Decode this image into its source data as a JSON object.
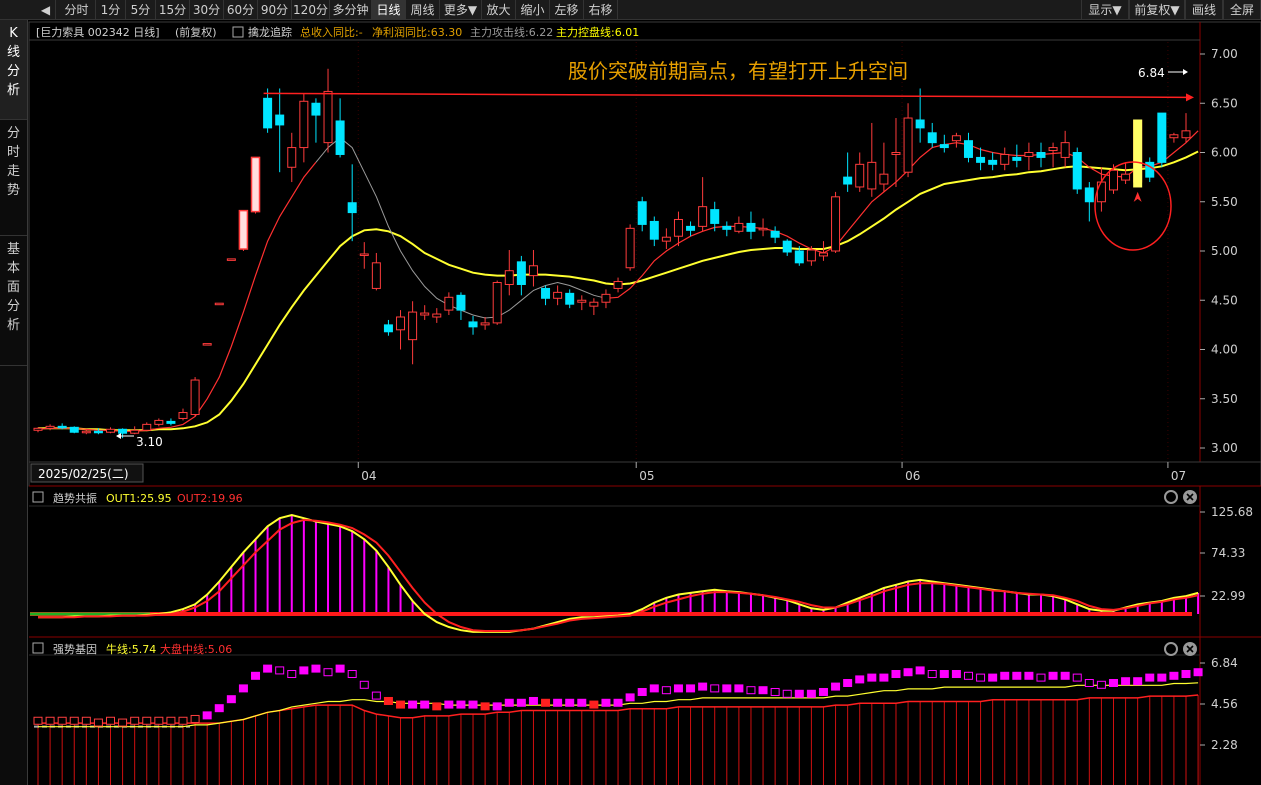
{
  "toolbar": {
    "items": [
      "分时",
      "1分",
      "5分",
      "15分",
      "30分",
      "60分",
      "90分",
      "120分",
      "多分钟",
      "日线",
      "周线",
      "更多▼",
      "放大",
      "缩小",
      "左移",
      "右移"
    ],
    "active": "日线",
    "right_items": [
      "显示▼",
      "前复权▼",
      "画线",
      "全屏"
    ]
  },
  "sidebar": {
    "tabs": [
      "K线分析",
      "分时走势",
      "基本面分析"
    ],
    "active": "K线分析"
  },
  "main_header": {
    "stock": "[巨力索具 002342 日线]",
    "adjust": "(前复权)",
    "indicator_name": "擒龙追踪",
    "items": [
      {
        "text": "总收入同比:-",
        "color": "#e0a000"
      },
      {
        "text": "净利润同比:63.30",
        "color": "#e0a000"
      },
      {
        "text": "主力攻击线:6.22",
        "color": "#9a9a9a"
      },
      {
        "text": "主力控盘线:6.01",
        "color": "#ffff00"
      }
    ]
  },
  "annotation": {
    "text": "股价突破前期高点，有望打开上升空间",
    "color": "#e8a000",
    "high_label": "6.84",
    "low_label": "3.10"
  },
  "date_axis": {
    "cursor_date": "2025/02/25(二)",
    "months": [
      "04",
      "05",
      "06",
      "07"
    ]
  },
  "price_axis": [
    "7.00",
    "6.50",
    "6.00",
    "5.50",
    "5.00",
    "4.50",
    "4.00",
    "3.50",
    "3.00"
  ],
  "panel2": {
    "name": "趋势共振",
    "out1": "OUT1:25.95",
    "out2": "OUT2:19.96",
    "axis": [
      "125.68",
      "74.33",
      "22.99"
    ]
  },
  "panel3": {
    "name": "强势基因",
    "bull": "牛线:5.74",
    "mid": "大盘中线:5.06",
    "axis": [
      "6.84",
      "4.56",
      "2.28"
    ]
  },
  "colors": {
    "up": "#ff3c3c",
    "down": "#00e5ff",
    "ma_yellow": "#ffff30",
    "ma_red": "#ff3030",
    "magenta": "#ff00ff"
  },
  "chart_data": {
    "type": "candlestick",
    "ylim": [
      3.0,
      7.0
    ],
    "candles": [
      [
        3.18,
        3.2,
        3.16,
        3.21
      ],
      [
        3.2,
        3.22,
        3.18,
        3.24
      ],
      [
        3.22,
        3.21,
        3.19,
        3.25
      ],
      [
        3.21,
        3.16,
        3.15,
        3.22
      ],
      [
        3.16,
        3.17,
        3.14,
        3.19
      ],
      [
        3.17,
        3.16,
        3.14,
        3.2
      ],
      [
        3.16,
        3.19,
        3.15,
        3.21
      ],
      [
        3.19,
        3.15,
        3.1,
        3.2
      ],
      [
        3.15,
        3.18,
        3.14,
        3.22
      ],
      [
        3.18,
        3.24,
        3.17,
        3.26
      ],
      [
        3.24,
        3.28,
        3.22,
        3.3
      ],
      [
        3.27,
        3.25,
        3.23,
        3.3
      ],
      [
        3.3,
        3.36,
        3.28,
        3.4
      ],
      [
        3.34,
        3.69,
        3.32,
        3.72
      ],
      [
        4.06,
        4.06,
        4.06,
        4.06
      ],
      [
        4.47,
        4.47,
        4.47,
        4.47
      ],
      [
        4.92,
        4.92,
        4.92,
        4.92
      ],
      [
        5.02,
        5.41,
        5.0,
        5.41
      ],
      [
        5.4,
        5.95,
        5.38,
        5.95
      ],
      [
        6.55,
        6.25,
        6.2,
        6.65
      ],
      [
        6.38,
        6.28,
        5.8,
        6.65
      ],
      [
        5.85,
        6.05,
        5.7,
        6.2
      ],
      [
        6.05,
        6.52,
        5.9,
        6.6
      ],
      [
        6.5,
        6.38,
        6.1,
        6.55
      ],
      [
        6.1,
        6.62,
        6.0,
        6.85
      ],
      [
        6.32,
        5.98,
        5.95,
        6.55
      ],
      [
        5.49,
        5.39,
        5.1,
        5.88
      ],
      [
        4.96,
        4.97,
        4.82,
        5.09
      ],
      [
        4.62,
        4.88,
        4.6,
        4.98
      ],
      [
        4.25,
        4.18,
        4.14,
        4.3
      ],
      [
        4.2,
        4.33,
        4.0,
        4.4
      ],
      [
        4.1,
        4.38,
        3.85,
        4.49
      ],
      [
        4.35,
        4.37,
        4.3,
        4.45
      ],
      [
        4.33,
        4.36,
        4.27,
        4.42
      ],
      [
        4.4,
        4.53,
        4.35,
        4.58
      ],
      [
        4.55,
        4.4,
        4.3,
        4.58
      ],
      [
        4.28,
        4.23,
        4.15,
        4.34
      ],
      [
        4.25,
        4.27,
        4.2,
        4.33
      ],
      [
        4.27,
        4.68,
        4.25,
        4.7
      ],
      [
        4.66,
        4.8,
        4.55,
        5.01
      ],
      [
        4.89,
        4.66,
        4.55,
        4.95
      ],
      [
        4.75,
        4.85,
        4.64,
        5.01
      ],
      [
        4.62,
        4.52,
        4.45,
        4.65
      ],
      [
        4.52,
        4.58,
        4.45,
        4.65
      ],
      [
        4.57,
        4.46,
        4.42,
        4.61
      ],
      [
        4.48,
        4.5,
        4.4,
        4.55
      ],
      [
        4.44,
        4.48,
        4.35,
        4.52
      ],
      [
        4.48,
        4.56,
        4.42,
        4.61
      ],
      [
        4.62,
        4.69,
        4.58,
        4.73
      ],
      [
        4.83,
        5.23,
        4.8,
        5.27
      ],
      [
        5.5,
        5.27,
        5.2,
        5.55
      ],
      [
        5.3,
        5.12,
        5.05,
        5.35
      ],
      [
        5.1,
        5.14,
        5.02,
        5.23
      ],
      [
        5.15,
        5.32,
        5.05,
        5.4
      ],
      [
        5.25,
        5.21,
        5.15,
        5.3
      ],
      [
        5.25,
        5.45,
        5.2,
        5.75
      ],
      [
        5.42,
        5.28,
        5.2,
        5.5
      ],
      [
        5.25,
        5.22,
        5.15,
        5.3
      ],
      [
        5.2,
        5.28,
        5.18,
        5.35
      ],
      [
        5.28,
        5.2,
        5.12,
        5.4
      ],
      [
        5.22,
        5.23,
        5.15,
        5.33
      ],
      [
        5.2,
        5.14,
        5.08,
        5.25
      ],
      [
        5.1,
        4.99,
        4.95,
        5.12
      ],
      [
        5.0,
        4.88,
        4.85,
        5.05
      ],
      [
        4.9,
        5.01,
        4.85,
        5.05
      ],
      [
        4.95,
        4.98,
        4.9,
        5.1
      ],
      [
        5.0,
        5.55,
        4.98,
        5.6
      ],
      [
        5.75,
        5.68,
        5.6,
        6.0
      ],
      [
        5.65,
        5.88,
        5.6,
        6.0
      ],
      [
        5.63,
        5.9,
        5.55,
        6.3
      ],
      [
        5.68,
        5.78,
        5.6,
        6.1
      ],
      [
        5.98,
        6.0,
        5.65,
        6.35
      ],
      [
        5.8,
        6.35,
        5.75,
        6.5
      ],
      [
        6.33,
        6.25,
        6.1,
        6.65
      ],
      [
        6.2,
        6.1,
        6.05,
        6.3
      ],
      [
        6.08,
        6.05,
        6.0,
        6.18
      ],
      [
        6.12,
        6.17,
        6.05,
        6.2
      ],
      [
        6.12,
        5.95,
        5.9,
        6.2
      ],
      [
        5.95,
        5.9,
        5.82,
        6.05
      ],
      [
        5.92,
        5.88,
        5.82,
        6.0
      ],
      [
        5.88,
        5.98,
        5.82,
        6.05
      ],
      [
        5.95,
        5.92,
        5.85,
        6.08
      ],
      [
        5.96,
        6.0,
        5.82,
        6.1
      ],
      [
        6.0,
        5.95,
        5.85,
        6.1
      ],
      [
        6.02,
        6.05,
        5.85,
        6.1
      ],
      [
        5.95,
        6.1,
        5.85,
        6.22
      ],
      [
        6.0,
        5.63,
        5.58,
        6.05
      ],
      [
        5.64,
        5.5,
        5.3,
        5.7
      ],
      [
        5.5,
        5.7,
        5.4,
        5.85
      ],
      [
        5.62,
        5.82,
        5.58,
        5.88
      ],
      [
        5.72,
        5.78,
        5.68,
        5.9
      ],
      [
        5.7,
        6.33,
        5.65,
        6.33
      ],
      [
        5.9,
        5.75,
        5.7,
        5.95
      ],
      [
        6.4,
        5.9,
        5.85,
        6.4
      ],
      [
        6.15,
        6.18,
        6.1,
        6.2
      ],
      [
        6.15,
        6.22,
        6.1,
        6.4
      ]
    ],
    "ma_short": [
      3.19,
      3.2,
      3.2,
      3.2,
      3.19,
      3.18,
      3.18,
      3.17,
      3.17,
      3.18,
      3.2,
      3.21,
      3.24,
      3.32,
      3.5,
      3.72,
      4.03,
      4.38,
      4.75,
      5.1,
      5.35,
      5.55,
      5.75,
      5.9,
      6.05,
      6.15,
      6.05,
      5.8,
      5.55,
      5.25,
      5.0,
      4.8,
      4.64,
      4.52,
      4.45,
      4.4,
      4.35,
      4.32,
      4.33,
      4.4,
      4.5,
      4.6,
      4.65,
      4.68,
      4.65,
      4.6,
      4.55,
      4.52,
      4.53,
      4.62,
      4.75,
      4.9,
      5.0,
      5.08,
      5.15,
      5.2,
      5.24,
      5.25,
      5.25,
      5.24,
      5.23,
      5.2,
      5.15,
      5.08,
      5.02,
      4.98,
      5.05,
      5.2,
      5.35,
      5.5,
      5.6,
      5.7,
      5.82,
      5.95,
      6.05,
      6.08,
      6.1,
      6.08,
      6.03,
      6.0,
      5.98,
      5.97,
      5.97,
      5.98,
      5.99,
      6.0,
      5.95,
      5.85,
      5.78,
      5.76,
      5.75,
      5.85,
      5.86,
      5.9,
      6.0,
      6.1,
      6.22
    ],
    "ma_long": [
      3.2,
      3.2,
      3.2,
      3.2,
      3.19,
      3.19,
      3.18,
      3.18,
      3.18,
      3.18,
      3.19,
      3.19,
      3.2,
      3.22,
      3.26,
      3.34,
      3.48,
      3.65,
      3.85,
      4.05,
      4.25,
      4.43,
      4.6,
      4.75,
      4.9,
      5.05,
      5.15,
      5.21,
      5.22,
      5.2,
      5.15,
      5.07,
      4.98,
      4.92,
      4.86,
      4.82,
      4.78,
      4.76,
      4.75,
      4.75,
      4.76,
      4.76,
      4.76,
      4.75,
      4.74,
      4.72,
      4.7,
      4.67,
      4.66,
      4.67,
      4.7,
      4.74,
      4.78,
      4.82,
      4.86,
      4.9,
      4.93,
      4.96,
      4.99,
      5.01,
      5.02,
      5.03,
      5.03,
      5.02,
      5.02,
      5.02,
      5.05,
      5.1,
      5.17,
      5.25,
      5.33,
      5.42,
      5.5,
      5.58,
      5.63,
      5.68,
      5.7,
      5.72,
      5.74,
      5.75,
      5.77,
      5.78,
      5.8,
      5.81,
      5.83,
      5.85,
      5.86,
      5.85,
      5.84,
      5.83,
      5.82,
      5.83,
      5.84,
      5.86,
      5.9,
      5.95,
      6.01
    ],
    "out1": [
      -4,
      -4,
      -4,
      -3,
      -3,
      -3,
      -2,
      -2,
      -2,
      -1,
      0,
      2,
      6,
      12,
      24,
      40,
      58,
      76,
      92,
      108,
      118,
      122,
      118,
      114,
      111,
      108,
      102,
      92,
      78,
      58,
      36,
      16,
      0,
      -10,
      -16,
      -20,
      -22,
      -22,
      -22,
      -22,
      -20,
      -18,
      -14,
      -10,
      -6,
      -4,
      -4,
      -3,
      -2,
      0,
      6,
      14,
      20,
      24,
      26,
      28,
      30,
      28,
      27,
      25,
      23,
      20,
      17,
      12,
      7,
      5,
      8,
      14,
      20,
      26,
      32,
      36,
      40,
      42,
      40,
      38,
      36,
      34,
      32,
      30,
      28,
      26,
      24,
      24,
      22,
      18,
      12,
      6,
      4,
      4,
      8,
      12,
      14,
      16,
      20,
      22,
      26
    ],
    "out2": [
      -4,
      -4,
      -4,
      -4,
      -3,
      -3,
      -3,
      -2,
      -2,
      -2,
      -1,
      0,
      3,
      8,
      16,
      28,
      44,
      60,
      76,
      90,
      104,
      112,
      116,
      115,
      113,
      110,
      106,
      98,
      88,
      72,
      52,
      32,
      14,
      0,
      -10,
      -16,
      -20,
      -21,
      -21,
      -21,
      -20,
      -18,
      -15,
      -12,
      -8,
      -6,
      -5,
      -4,
      -3,
      -2,
      3,
      9,
      14,
      18,
      22,
      25,
      27,
      27,
      26,
      25,
      23,
      21,
      18,
      15,
      11,
      8,
      8,
      12,
      17,
      22,
      28,
      32,
      36,
      38,
      38,
      37,
      35,
      33,
      31,
      29,
      28,
      26,
      25,
      24,
      23,
      20,
      16,
      10,
      6,
      5,
      7,
      10,
      13,
      15,
      18,
      20,
      23
    ],
    "p3_squares": [
      3.6,
      3.6,
      3.6,
      3.6,
      3.6,
      3.5,
      3.6,
      3.5,
      3.6,
      3.6,
      3.6,
      3.6,
      3.6,
      3.7,
      3.9,
      4.3,
      4.8,
      5.4,
      6.1,
      6.5,
      6.4,
      6.2,
      6.4,
      6.5,
      6.3,
      6.5,
      6.2,
      5.6,
      5.0,
      4.7,
      4.5,
      4.5,
      4.5,
      4.4,
      4.5,
      4.5,
      4.5,
      4.4,
      4.4,
      4.6,
      4.6,
      4.7,
      4.6,
      4.6,
      4.6,
      4.6,
      4.5,
      4.6,
      4.6,
      4.9,
      5.2,
      5.4,
      5.3,
      5.4,
      5.4,
      5.5,
      5.4,
      5.4,
      5.4,
      5.3,
      5.3,
      5.2,
      5.1,
      5.1,
      5.1,
      5.2,
      5.5,
      5.7,
      5.9,
      6.0,
      6.0,
      6.2,
      6.3,
      6.4,
      6.2,
      6.2,
      6.2,
      6.1,
      6.0,
      6.0,
      6.1,
      6.1,
      6.1,
      6.0,
      6.1,
      6.1,
      6.0,
      5.7,
      5.6,
      5.7,
      5.8,
      5.8,
      6.0,
      6.0,
      6.1,
      6.2,
      6.3
    ],
    "p3_yellow": [
      3.3,
      3.3,
      3.3,
      3.3,
      3.3,
      3.3,
      3.3,
      3.3,
      3.3,
      3.3,
      3.3,
      3.3,
      3.3,
      3.4,
      3.4,
      3.5,
      3.6,
      3.7,
      3.9,
      4.1,
      4.2,
      4.4,
      4.5,
      4.6,
      4.7,
      4.7,
      4.8,
      4.8,
      4.7,
      4.7,
      4.6,
      4.6,
      4.6,
      4.6,
      4.5,
      4.5,
      4.5,
      4.5,
      4.5,
      4.5,
      4.5,
      4.5,
      4.5,
      4.5,
      4.5,
      4.5,
      4.5,
      4.5,
      4.5,
      4.6,
      4.6,
      4.7,
      4.7,
      4.8,
      4.8,
      4.9,
      4.9,
      4.9,
      4.9,
      4.9,
      4.9,
      4.9,
      4.9,
      4.9,
      4.9,
      4.9,
      5.0,
      5.0,
      5.1,
      5.2,
      5.3,
      5.3,
      5.4,
      5.4,
      5.4,
      5.5,
      5.5,
      5.5,
      5.5,
      5.5,
      5.5,
      5.5,
      5.5,
      5.5,
      5.5,
      5.5,
      5.6,
      5.6,
      5.6,
      5.6,
      5.6,
      5.6,
      5.6,
      5.6,
      5.7,
      5.7,
      5.74
    ],
    "p3_red_bars": [
      3.5,
      3.5,
      3.5,
      3.5,
      3.5,
      3.5,
      3.5,
      3.5,
      3.5,
      3.5,
      3.5,
      3.5,
      3.5,
      3.5,
      3.5,
      3.5,
      3.6,
      3.7,
      3.9,
      4.1,
      4.2,
      4.3,
      4.4,
      4.5,
      4.5,
      4.5,
      4.5,
      4.2,
      4.0,
      3.9,
      3.8,
      3.8,
      3.9,
      3.9,
      3.9,
      4.0,
      4.0,
      4.0,
      4.1,
      4.1,
      4.2,
      4.2,
      4.2,
      4.2,
      4.2,
      4.2,
      4.2,
      4.2,
      4.2,
      4.3,
      4.3,
      4.3,
      4.3,
      4.4,
      4.4,
      4.4,
      4.4,
      4.4,
      4.4,
      4.4,
      4.4,
      4.4,
      4.4,
      4.4,
      4.4,
      4.4,
      4.5,
      4.5,
      4.6,
      4.6,
      4.6,
      4.6,
      4.7,
      4.7,
      4.7,
      4.7,
      4.7,
      4.7,
      4.7,
      4.8,
      4.8,
      4.8,
      4.8,
      4.8,
      4.8,
      4.8,
      4.8,
      4.9,
      4.9,
      4.9,
      4.9,
      4.9,
      5.0,
      5.0,
      5.0,
      5.0,
      5.06
    ]
  }
}
